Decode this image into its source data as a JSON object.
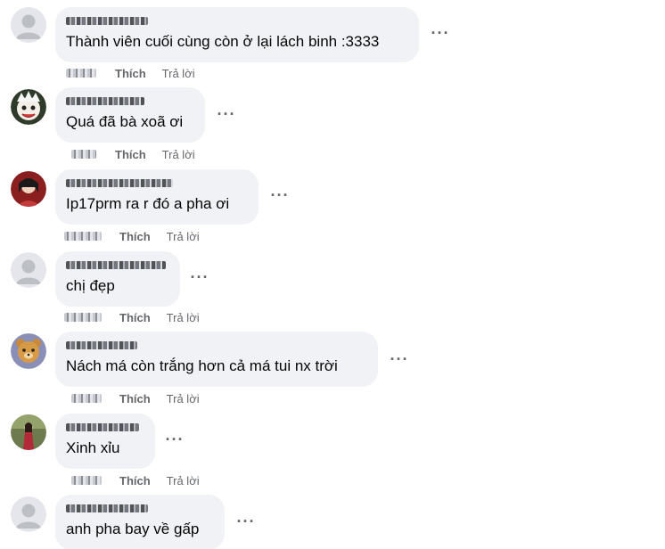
{
  "colors": {
    "bubble": "#f0f2f5",
    "meta_text": "#65676b",
    "body_text": "#050505",
    "default_avatar": "#bcc0c4"
  },
  "comments": [
    {
      "avatar": "default-avatar-icon",
      "text": "Thành viên cuối cùng còn ở lại lách binh :3333",
      "more": "···",
      "like": "Thích",
      "reply": "Trả lời"
    },
    {
      "avatar": "profile-photo-anime",
      "text": "Quá đã bà xoã ơi",
      "more": "···",
      "like": "Thích",
      "reply": "Trả lời"
    },
    {
      "avatar": "profile-photo-red",
      "text": "Ip17prm ra r đó a pha ơi",
      "more": "···",
      "like": "Thích",
      "reply": "Trả lời"
    },
    {
      "avatar": "default-avatar-icon",
      "text": "chị đẹp",
      "more": "···",
      "like": "Thích",
      "reply": "Trả lời"
    },
    {
      "avatar": "profile-photo-cartoon-bear",
      "text": "Nách má còn trắng hơn cả má tui nx trời",
      "more": "···",
      "like": "Thích",
      "reply": "Trả lời"
    },
    {
      "avatar": "profile-photo-person",
      "text": "Xinh xỉu",
      "more": "···",
      "like": "Thích",
      "reply": "Trả lời"
    },
    {
      "avatar": "default-avatar-icon",
      "text": "anh pha bay về gấp",
      "more": "···",
      "like": "Thích",
      "reply": "Trả lời"
    }
  ]
}
